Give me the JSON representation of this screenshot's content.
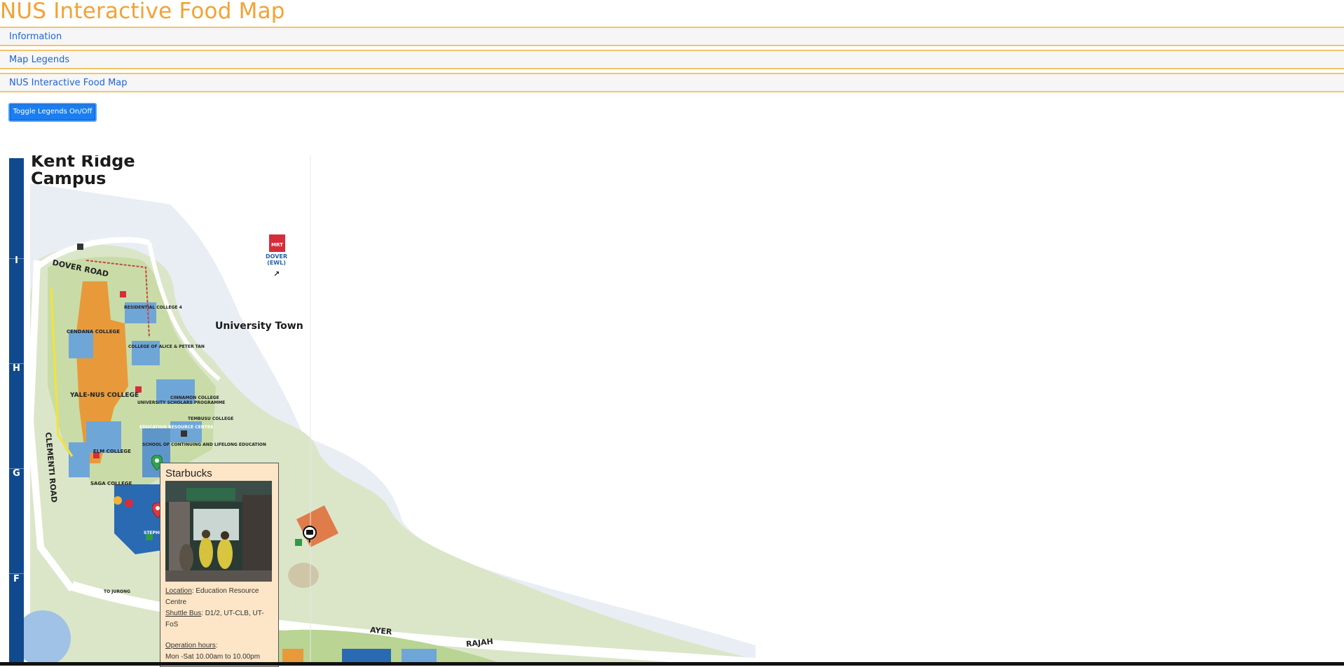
{
  "page": {
    "title": "NUS Interactive Food Map"
  },
  "accordion": [
    {
      "label": "Information"
    },
    {
      "label": "Map Legends"
    },
    {
      "label": "NUS Interactive Food Map"
    }
  ],
  "toggle_button": {
    "label": "Toggle Legends On/Off"
  },
  "map": {
    "campus_title_line1": "Kent Ridge",
    "campus_title_line2": "Campus",
    "grid_labels": [
      "I",
      "H",
      "G",
      "F"
    ],
    "roads": {
      "dover": "DOVER ROAD",
      "clementi": "CLEMENTI ROAD",
      "ayer": "AYER",
      "rajah": "RAJAH"
    },
    "areas": {
      "university_town": "University Town",
      "mrt_label": "DOVER\n(EWL)",
      "mrt_badge": "MRT",
      "cendana": "CENDANA COLLEGE",
      "yale_nus": "YALE-NUS COLLEGE",
      "elm": "ELM COLLEGE",
      "saga": "SAGA COLLEGE",
      "residential_college_4": "RESIDENTIAL COLLEGE 4",
      "alice_peter_tan": "COLLEGE OF ALICE & PETER TAN",
      "cinnamon": "CINNAMON COLLEGE",
      "tembusu": "TEMBUSU COLLEGE",
      "usp": "UNIVERSITY SCHOLARS PROGRAMME",
      "erc": "EDUCATION RESOURCE CENTRE",
      "scale": "SCHOOL OF CONTINUING AND LIFELONG EDUCATION",
      "stephen": "STEPHEN",
      "to_jurong": "TO JURONG"
    }
  },
  "popup": {
    "title": "Starbucks",
    "location_label": "Location",
    "location_value": ": Education Resource Centre",
    "bus_label": "Shuttle Bus",
    "bus_value": ": D1/2, UT-CLB, UT-FoS",
    "hours_label": "Operation hours",
    "hours_sep": ":",
    "hours_value": "Mon -Sat 10.00am to 10.00pm"
  },
  "colors": {
    "title": "#f4a233",
    "accordion_border": "#f4c36b",
    "link": "#1f64d6",
    "button": "#1a7ef2",
    "grid_bar": "#10498d",
    "popup_bg": "#fce6c7"
  }
}
